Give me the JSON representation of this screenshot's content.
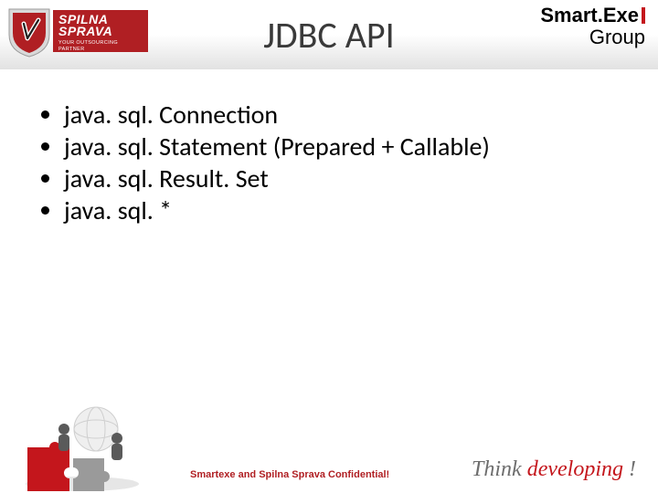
{
  "header": {
    "logo_left_main": "SPILNA\nSPRAVA",
    "logo_left_sub": "YOUR OUTSOURCING PARTNER",
    "logo_right_line1": "Smart.Exe",
    "logo_right_line2": "Group"
  },
  "title": "JDBC API",
  "bullets": [
    "java. sql. Connection",
    "java. sql. Statement (Prepared + Callable)",
    "java. sql. Result. Set",
    "java. sql. *"
  ],
  "footer": {
    "confidential": "Smartexe and Spilna Sprava Confidential!",
    "think_prefix": "Think ",
    "think_highlight": "developing",
    "think_suffix": " !"
  }
}
